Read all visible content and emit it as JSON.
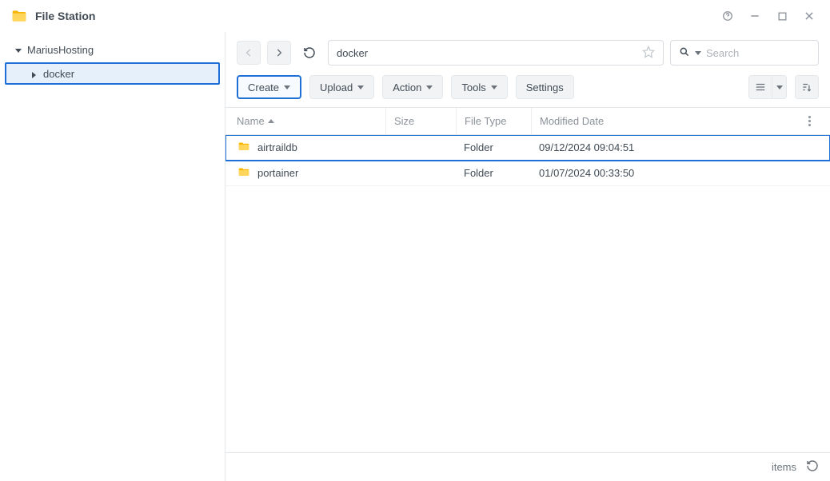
{
  "titlebar": {
    "title": "File Station"
  },
  "sidebar": {
    "root": {
      "label": "MariusHosting"
    },
    "child": {
      "label": "docker"
    }
  },
  "nav": {
    "path": "docker",
    "search_placeholder": "Search"
  },
  "toolbar": {
    "create": "Create",
    "upload": "Upload",
    "action": "Action",
    "tools": "Tools",
    "settings": "Settings"
  },
  "columns": {
    "name": "Name",
    "size": "Size",
    "type": "File Type",
    "modified": "Modified Date"
  },
  "rows": [
    {
      "name": "airtraildb",
      "size": "",
      "type": "Folder",
      "modified": "09/12/2024 09:04:51",
      "selected": true
    },
    {
      "name": "portainer",
      "size": "",
      "type": "Folder",
      "modified": "01/07/2024 00:33:50",
      "selected": false
    }
  ],
  "statusbar": {
    "items_label": "items"
  }
}
